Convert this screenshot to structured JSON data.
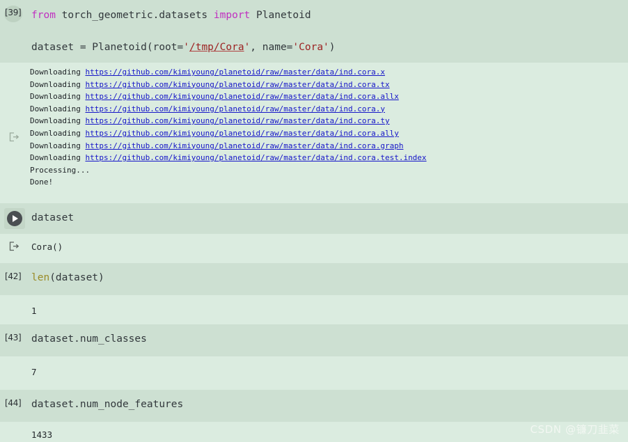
{
  "cells": [
    {
      "exec_label": "[39]",
      "code_lines": [
        [
          {
            "t": "from",
            "c": "kw"
          },
          {
            "t": " torch_geometric.datasets ",
            "c": "plain"
          },
          {
            "t": "import",
            "c": "kw"
          },
          {
            "t": " Planetoid",
            "c": "plain"
          }
        ],
        [
          {
            "t": "dataset = Planetoid(root=",
            "c": "plain"
          },
          {
            "t": "'",
            "c": "str"
          },
          {
            "t": "/tmp/Cora",
            "c": "str-url"
          },
          {
            "t": "'",
            "c": "str"
          },
          {
            "t": ", name=",
            "c": "plain"
          },
          {
            "t": "'Cora'",
            "c": "str"
          },
          {
            "t": ")",
            "c": "plain"
          }
        ]
      ]
    }
  ],
  "download_output": {
    "icon": "output-arrow-icon",
    "lines": [
      {
        "prefix": "Downloading ",
        "url": "https://github.com/kimiyoung/planetoid/raw/master/data/ind.cora.x"
      },
      {
        "prefix": "Downloading ",
        "url": "https://github.com/kimiyoung/planetoid/raw/master/data/ind.cora.tx"
      },
      {
        "prefix": "Downloading ",
        "url": "https://github.com/kimiyoung/planetoid/raw/master/data/ind.cora.allx"
      },
      {
        "prefix": "Downloading ",
        "url": "https://github.com/kimiyoung/planetoid/raw/master/data/ind.cora.y"
      },
      {
        "prefix": "Downloading ",
        "url": "https://github.com/kimiyoung/planetoid/raw/master/data/ind.cora.ty"
      },
      {
        "prefix": "Downloading ",
        "url": "https://github.com/kimiyoung/planetoid/raw/master/data/ind.cora.ally"
      },
      {
        "prefix": "Downloading ",
        "url": "https://github.com/kimiyoung/planetoid/raw/master/data/ind.cora.graph"
      },
      {
        "prefix": "Downloading ",
        "url": "https://github.com/kimiyoung/planetoid/raw/master/data/ind.cora.test.index"
      },
      {
        "prefix": "Processing...",
        "url": ""
      },
      {
        "prefix": "Done!",
        "url": ""
      }
    ]
  },
  "cell_dataset": {
    "run_icon": "play-icon",
    "code": "dataset",
    "output_icon": "output-arrow-icon",
    "output": "Cora()"
  },
  "cell_len": {
    "exec_label": "[42]",
    "code_builtin": "len",
    "code_rest": "(dataset)",
    "output": "1"
  },
  "cell_num_classes": {
    "exec_label": "[43]",
    "code": "dataset.num_classes",
    "output": "7"
  },
  "cell_num_node_features": {
    "exec_label": "[44]",
    "code": "dataset.num_node_features",
    "output": "1433"
  },
  "watermark": "CSDN @镰刀韭菜",
  "colors": {
    "code_cell_bg": "#cde0d2",
    "output_cell_bg": "#dbece0",
    "keyword": "#c030c0",
    "string": "#9c2222",
    "builtin": "#9a8b27",
    "link": "#1515c8",
    "text": "#32383c"
  }
}
